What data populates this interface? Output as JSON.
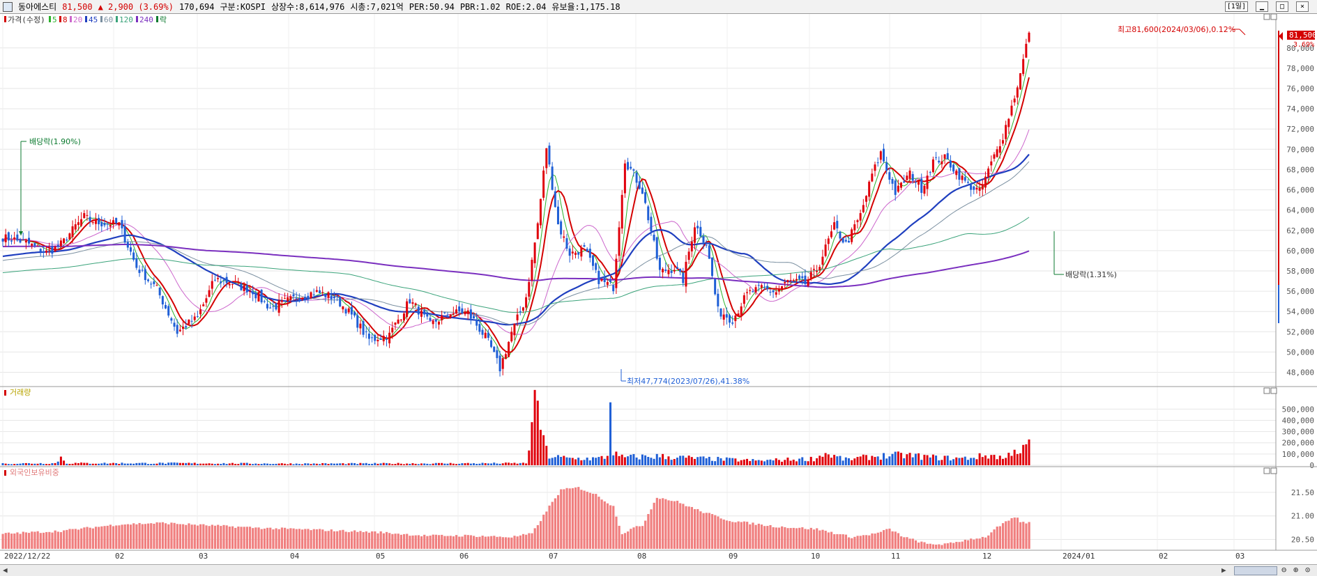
{
  "header": {
    "name": "동아에스티",
    "price": "81,500",
    "change": "▲ 2,900 (3.69%)",
    "volume": "170,694",
    "market": "구분:KOSPI",
    "shares": "상장수:8,614,976",
    "mcap": "시총:7,021억",
    "per": "PER:50.94",
    "pbr": "PBR:1.02",
    "roe": "ROE:2.04",
    "float": "유보율:1,175.18",
    "period_button": "[1일]"
  },
  "legend": {
    "items": [
      {
        "label": "가격(수정)",
        "color": "#d40000"
      },
      {
        "label": "5",
        "color": "#2bb12b"
      },
      {
        "label": "8",
        "color": "#d40000"
      },
      {
        "label": "20",
        "color": "#cc66cc"
      },
      {
        "label": "45",
        "color": "#1f3fbf"
      },
      {
        "label": "60",
        "color": "#7a8fa0"
      },
      {
        "label": "120",
        "color": "#3aa37a"
      },
      {
        "label": "240",
        "color": "#7a2fbf"
      },
      {
        "label": "락",
        "color": "#0b7a2f"
      }
    ]
  },
  "annotations": {
    "dividend1": "배당락(1.90%)",
    "dividend2": "배당락(1.31%)",
    "high": "최고81,600(2024/03/06),0.12%",
    "low": "최저47,774(2023/07/26),41.38%",
    "current_price": "81,500",
    "current_pct": "3.69%"
  },
  "volume_panel": {
    "title": "거래량"
  },
  "foreign_panel": {
    "title": "외국인보유비중"
  },
  "colors": {
    "up": "#e0000b",
    "down": "#1f5fd6",
    "grid": "#e6e6e6",
    "label": "#555555"
  },
  "chart_data": {
    "type": "candlestick",
    "price_axis": {
      "ticks": [
        48000,
        50000,
        52000,
        54000,
        56000,
        58000,
        60000,
        62000,
        64000,
        66000,
        68000,
        70000,
        72000,
        74000,
        76000,
        78000,
        80000
      ],
      "tick_labels": [
        "48,000",
        "50,000",
        "52,000",
        "54,000",
        "56,000",
        "58,000",
        "60,000",
        "62,000",
        "64,000",
        "66,000",
        "68,000",
        "70,000",
        "72,000",
        "74,000",
        "76,000",
        "78,000",
        "80,000"
      ],
      "range": [
        46800,
        82800
      ]
    },
    "volume_axis": {
      "ticks": [
        0,
        100000,
        200000,
        300000,
        400000,
        500000
      ],
      "tick_labels": [
        "0",
        "100,000",
        "200,000",
        "300,000",
        "400,000",
        "500,000"
      ],
      "range": [
        0,
        620000
      ]
    },
    "foreign_axis": {
      "ticks": [
        20.5,
        21.0,
        21.5
      ],
      "tick_labels": [
        "20.50",
        "21.00",
        "21.50"
      ],
      "range": [
        20.3,
        21.75
      ]
    },
    "x_axis": {
      "labels": [
        "2022/12/22",
        "02",
        "03",
        "04",
        "05",
        "06",
        "07",
        "08",
        "09",
        "10",
        "11",
        "12",
        "2024/01",
        "02",
        "03"
      ]
    },
    "close_keypoints": [
      [
        0,
        61300
      ],
      [
        8,
        60800
      ],
      [
        15,
        59800
      ],
      [
        20,
        60600
      ],
      [
        25,
        62400
      ],
      [
        28,
        63300
      ],
      [
        32,
        62800
      ],
      [
        40,
        62600
      ],
      [
        46,
        58400
      ],
      [
        53,
        56200
      ],
      [
        60,
        52000
      ],
      [
        67,
        53400
      ],
      [
        73,
        57200
      ],
      [
        80,
        56700
      ],
      [
        86,
        56000
      ],
      [
        92,
        54300
      ],
      [
        100,
        55300
      ],
      [
        108,
        55900
      ],
      [
        114,
        55400
      ],
      [
        120,
        53600
      ],
      [
        126,
        51200
      ],
      [
        133,
        51700
      ],
      [
        140,
        55100
      ],
      [
        147,
        52700
      ],
      [
        154,
        53900
      ],
      [
        160,
        53900
      ],
      [
        167,
        51000
      ],
      [
        171,
        48400
      ],
      [
        175,
        51900
      ],
      [
        180,
        55400
      ],
      [
        184,
        62600
      ],
      [
        187,
        70200
      ],
      [
        191,
        62600
      ],
      [
        195,
        59700
      ],
      [
        200,
        60100
      ],
      [
        205,
        57100
      ],
      [
        210,
        56400
      ],
      [
        214,
        69000
      ],
      [
        220,
        65900
      ],
      [
        226,
        57900
      ],
      [
        231,
        58300
      ],
      [
        234,
        57100
      ],
      [
        238,
        62600
      ],
      [
        242,
        60700
      ],
      [
        246,
        54100
      ],
      [
        251,
        53200
      ],
      [
        256,
        55700
      ],
      [
        261,
        56300
      ],
      [
        266,
        55900
      ],
      [
        270,
        57000
      ],
      [
        276,
        56800
      ],
      [
        280,
        58100
      ],
      [
        286,
        62400
      ],
      [
        290,
        60600
      ],
      [
        295,
        63500
      ],
      [
        299,
        67500
      ],
      [
        302,
        69600
      ],
      [
        307,
        65700
      ],
      [
        312,
        67600
      ],
      [
        316,
        66100
      ],
      [
        320,
        68800
      ],
      [
        324,
        69100
      ],
      [
        328,
        67800
      ],
      [
        332,
        66500
      ],
      [
        336,
        65800
      ],
      [
        340,
        68600
      ],
      [
        344,
        71300
      ],
      [
        347,
        74200
      ],
      [
        350,
        77400
      ],
      [
        353,
        81500
      ]
    ],
    "volume_keypoints": [
      [
        0,
        15000
      ],
      [
        18,
        18000
      ],
      [
        20,
        70000
      ],
      [
        22,
        18000
      ],
      [
        60,
        18000
      ],
      [
        100,
        14000
      ],
      [
        150,
        16000
      ],
      [
        180,
        18000
      ],
      [
        184,
        640000
      ],
      [
        185,
        350000
      ],
      [
        186,
        200000
      ],
      [
        188,
        80000
      ],
      [
        195,
        60000
      ],
      [
        205,
        60000
      ],
      [
        208,
        80000
      ],
      [
        209,
        660000
      ],
      [
        210,
        120000
      ],
      [
        212,
        70000
      ],
      [
        225,
        80000
      ],
      [
        240,
        60000
      ],
      [
        260,
        40000
      ],
      [
        280,
        60000
      ],
      [
        282,
        110000
      ],
      [
        290,
        50000
      ],
      [
        300,
        80000
      ],
      [
        310,
        90000
      ],
      [
        320,
        70000
      ],
      [
        330,
        60000
      ],
      [
        340,
        90000
      ],
      [
        345,
        60000
      ],
      [
        348,
        160000
      ],
      [
        350,
        110000
      ],
      [
        353,
        190000
      ]
    ],
    "foreign_keypoints": [
      [
        0,
        20.62
      ],
      [
        20,
        20.68
      ],
      [
        40,
        20.82
      ],
      [
        55,
        20.85
      ],
      [
        70,
        20.8
      ],
      [
        90,
        20.74
      ],
      [
        110,
        20.7
      ],
      [
        130,
        20.65
      ],
      [
        145,
        20.58
      ],
      [
        160,
        20.58
      ],
      [
        175,
        20.55
      ],
      [
        182,
        20.62
      ],
      [
        188,
        21.2
      ],
      [
        192,
        21.55
      ],
      [
        198,
        21.6
      ],
      [
        204,
        21.45
      ],
      [
        210,
        21.2
      ],
      [
        213,
        20.62
      ],
      [
        216,
        20.72
      ],
      [
        220,
        20.8
      ],
      [
        225,
        21.4
      ],
      [
        232,
        21.3
      ],
      [
        240,
        21.1
      ],
      [
        250,
        20.9
      ],
      [
        265,
        20.78
      ],
      [
        280,
        20.72
      ],
      [
        292,
        20.55
      ],
      [
        300,
        20.62
      ],
      [
        305,
        20.72
      ],
      [
        310,
        20.55
      ],
      [
        318,
        20.4
      ],
      [
        325,
        20.4
      ],
      [
        332,
        20.5
      ],
      [
        338,
        20.55
      ],
      [
        342,
        20.75
      ],
      [
        346,
        20.9
      ],
      [
        349,
        20.98
      ],
      [
        350,
        20.85
      ],
      [
        353,
        20.86
      ]
    ]
  }
}
